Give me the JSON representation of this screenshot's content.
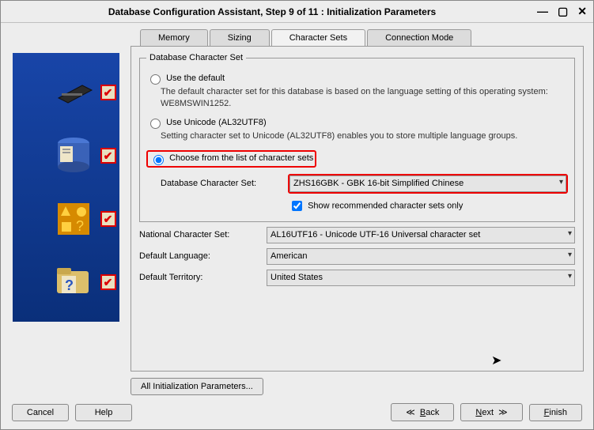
{
  "title": "Database Configuration Assistant, Step 9 of 11 : Initialization Parameters",
  "tabs": {
    "memory": "Memory",
    "sizing": "Sizing",
    "charsets": "Character Sets",
    "connmode": "Connection Mode"
  },
  "charset": {
    "legend": "Database Character Set",
    "opt_default": "Use the default",
    "desc_default": "The default character set for this database is based on the language setting of this operating system: WE8MSWIN1252.",
    "opt_unicode": "Use Unicode (AL32UTF8)",
    "desc_unicode": "Setting character set to Unicode (AL32UTF8) enables you to store multiple language groups.",
    "opt_choose": "Choose from the list of character sets",
    "db_charset_label": "Database Character Set:",
    "db_charset_value": "ZHS16GBK - GBK 16-bit Simplified Chinese",
    "recommended_label": "Show recommended character sets only"
  },
  "national": {
    "label": "National Character Set:",
    "value": "AL16UTF16 - Unicode UTF-16 Universal character set"
  },
  "language": {
    "label": "Default Language:",
    "value": "American"
  },
  "territory": {
    "label": "Default Territory:",
    "value": "United States"
  },
  "buttons": {
    "all_params": "All Initialization Parameters...",
    "cancel": "Cancel",
    "help": "Help",
    "back": "Back",
    "next": "Next",
    "finish": "Finish"
  }
}
